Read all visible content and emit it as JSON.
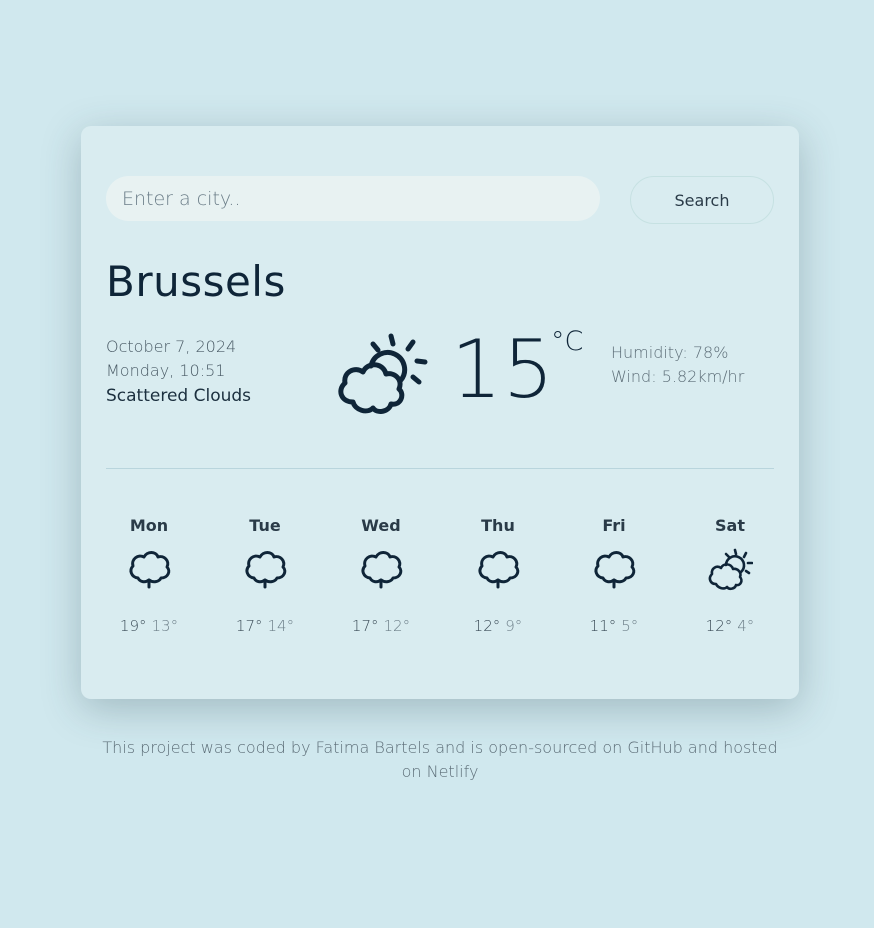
{
  "search": {
    "placeholder": "Enter a city..",
    "button_label": "Search"
  },
  "current": {
    "city": "Brussels",
    "date": "October 7, 2024",
    "day_time": "Monday, 10:51",
    "description": "Scattered Clouds",
    "icon": "partly-cloudy-icon",
    "temperature": "15",
    "unit": "°C",
    "humidity": "Humidity: 78%",
    "wind": "Wind: 5.82km/hr"
  },
  "forecast": [
    {
      "day": "Mon",
      "icon": "cloud-icon",
      "max": "19°",
      "min": "13°"
    },
    {
      "day": "Tue",
      "icon": "cloud-icon",
      "max": "17°",
      "min": "14°"
    },
    {
      "day": "Wed",
      "icon": "cloud-icon",
      "max": "17°",
      "min": "12°"
    },
    {
      "day": "Thu",
      "icon": "cloud-icon",
      "max": "12°",
      "min": "9°"
    },
    {
      "day": "Fri",
      "icon": "cloud-icon",
      "max": "11°",
      "min": "5°"
    },
    {
      "day": "Sat",
      "icon": "partly-cloudy-icon",
      "max": "12°",
      "min": "4°"
    }
  ],
  "footer": {
    "text": "This project was coded by Fatima Bartels and is open-sourced on GitHub and hosted on Netlify"
  },
  "colors": {
    "background": "#d0e8ee",
    "card": "#d9ecf0",
    "text_dark": "#0f2538"
  }
}
